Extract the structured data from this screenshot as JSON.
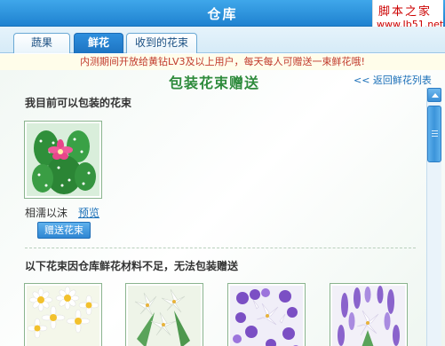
{
  "window": {
    "title": "仓库"
  },
  "watermark": {
    "line1": "脚本之家",
    "line2": "www.Jb51.net"
  },
  "tabs": [
    {
      "label": "蔬果",
      "active": false
    },
    {
      "label": "鲜花",
      "active": true
    },
    {
      "label": "收到的花束",
      "active": false
    }
  ],
  "notice": "内测期间开放给黄钻LV3及以上用户，每天每人可赠送一束鲜花哦!",
  "main": {
    "heading": "包装花束赠送",
    "back_link": "<< 返回鲜花列表",
    "available_heading": "我目前可以包装的花束",
    "available_bouquets": [
      {
        "name": "相濡以沫",
        "preview_label": "预览",
        "action_label": "赠送花束",
        "icon": "cactus-flower-image"
      }
    ],
    "unavailable_heading": "以下花束因仓库鲜花材料不足，无法包装赠送",
    "unavailable_bouquets": [
      {
        "icon": "daisy-bouquet-image"
      },
      {
        "icon": "white-lily-bouquet-image"
      },
      {
        "icon": "purple-white-bouquet-image"
      },
      {
        "icon": "lavender-lily-bouquet-image"
      }
    ]
  },
  "colors": {
    "title_bar": "#1f82d0",
    "heading_green": "#2e8b3c",
    "notice_red": "#c0392b",
    "link_blue": "#1a6fb8"
  }
}
